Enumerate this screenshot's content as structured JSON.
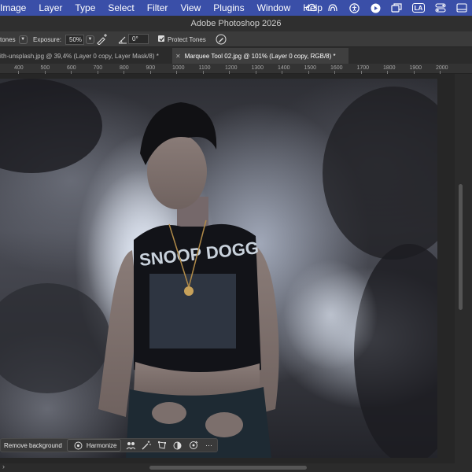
{
  "menubar": {
    "items": [
      "Image",
      "Layer",
      "Type",
      "Select",
      "Filter",
      "View",
      "Plugins",
      "Window",
      "Help"
    ],
    "status_icons": [
      "creative-cloud-icon",
      "airdrop-icon",
      "accessibility-icon",
      "play-icon",
      "window-icon",
      "input-language-icon",
      "control-center-icon",
      "notification-icon"
    ],
    "input_language": "LA"
  },
  "window": {
    "title": "Adobe Photoshop 2026"
  },
  "options_bar": {
    "range_value": "tones",
    "exposure_label": "Exposure:",
    "exposure_value": "50%",
    "angle_value": "0°",
    "protect_tones_label": "Protect Tones",
    "protect_tones_checked": true
  },
  "tabs": [
    {
      "label": "ith-unsplash.jpg @ 39,4% (Layer 0 copy, Layer Mask/8) *",
      "active": false
    },
    {
      "label": "Marquee Tool 02.jpg @ 101% (Layer 0 copy, RGB/8) *",
      "active": true
    }
  ],
  "ruler": {
    "ticks": [
      "400",
      "500",
      "600",
      "700",
      "800",
      "900",
      "1000",
      "1100",
      "1200",
      "1300",
      "1400",
      "1500",
      "1600",
      "1700",
      "1800",
      "1900",
      "2000"
    ]
  },
  "contextual_taskbar": {
    "remove_background": "Remove background",
    "harmonize": "Harmonize"
  },
  "colors": {
    "menubar": "#3a4fa8",
    "panel": "#3b3b3b",
    "canvas_bg": "#262626"
  }
}
